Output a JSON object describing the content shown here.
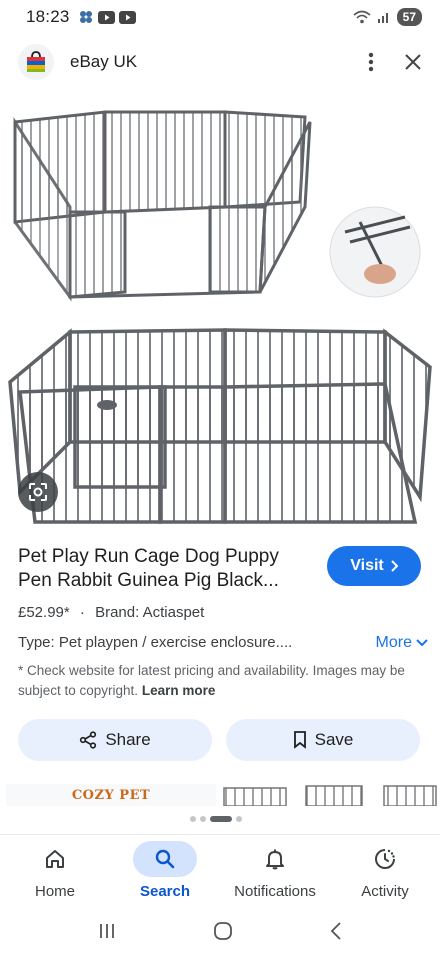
{
  "status_bar": {
    "time": "18:23",
    "battery": "57"
  },
  "header": {
    "site_name": "eBay UK",
    "logo_icon": "ebay-bag-icon"
  },
  "product": {
    "title": "Pet Play Run Cage Dog Puppy Pen Rabbit Guinea Pig Black...",
    "visit_label": "Visit",
    "price": "£52.99*",
    "separator": "·",
    "brand": "Brand: Actiaspet",
    "type": "Type: Pet playpen / exercise enclosure....",
    "more_label": "More",
    "disclaimer": "* Check website for latest pricing and availability. Images may be subject to copyright.",
    "learn_more": "Learn more"
  },
  "actions": {
    "share_label": "Share",
    "save_label": "Save"
  },
  "carousel": {
    "first_thumb_text": "COZY PET"
  },
  "bottom_nav": {
    "items": [
      {
        "label": "Home",
        "icon": "home-icon"
      },
      {
        "label": "Search",
        "icon": "search-icon",
        "active": true
      },
      {
        "label": "Notifications",
        "icon": "bell-icon"
      },
      {
        "label": "Activity",
        "icon": "activity-icon"
      }
    ]
  },
  "colors": {
    "accent": "#1a73e8",
    "button_bg": "#e8f0fe",
    "active_nav": "#0b57d0"
  }
}
